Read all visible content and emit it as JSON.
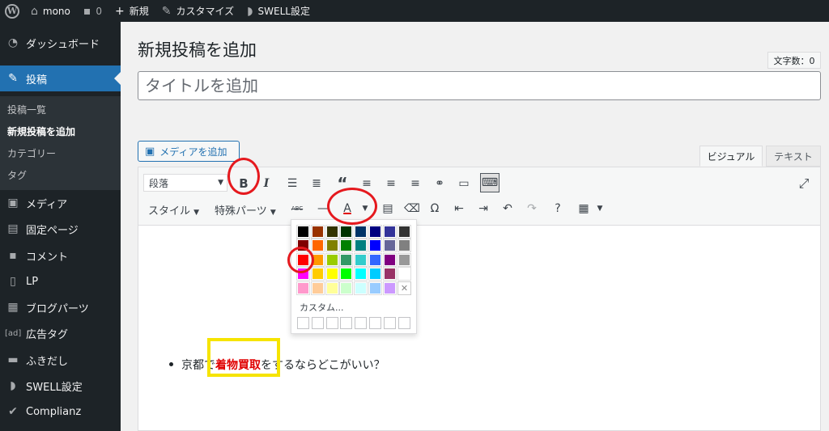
{
  "admin_bar": {
    "site_name": "mono",
    "comments_count": "0",
    "new_label": "新規",
    "customize_label": "カスタマイズ",
    "swell_label": "SWELL設定"
  },
  "sidebar": {
    "items": [
      {
        "label": "ダッシュボード",
        "icon": "dashboard-icon"
      },
      {
        "label": "投稿",
        "icon": "pin-icon"
      },
      {
        "label": "メディア",
        "icon": "media-icon"
      },
      {
        "label": "固定ページ",
        "icon": "page-icon"
      },
      {
        "label": "コメント",
        "icon": "comment-icon"
      },
      {
        "label": "LP",
        "icon": "document-icon"
      },
      {
        "label": "ブログパーツ",
        "icon": "layout-icon"
      },
      {
        "label": "広告タグ",
        "icon": "ad-icon"
      },
      {
        "label": "ふきだし",
        "icon": "speech-icon"
      },
      {
        "label": "SWELL設定",
        "icon": "swell-icon"
      },
      {
        "label": "Complianz",
        "icon": "check-icon"
      }
    ],
    "ad_icon_text": "[ad]",
    "submenu": [
      {
        "label": "投稿一覧"
      },
      {
        "label": "新規投稿を追加"
      },
      {
        "label": "カテゴリー"
      },
      {
        "label": "タグ"
      }
    ]
  },
  "page": {
    "title": "新規投稿を追加",
    "word_count": "文字数：0",
    "title_placeholder": "タイトルを追加",
    "media_button": "メディアを追加",
    "tab_visual": "ビジュアル",
    "tab_text": "テキスト"
  },
  "toolbar": {
    "format_select": "段落",
    "style_label": "スタイル",
    "special_parts_label": "特殊パーツ",
    "bold_glyph": "B",
    "italic_glyph": "I",
    "text_color_glyph": "A",
    "strike_glyph": "ABC"
  },
  "color_picker": {
    "custom_label": "カスタム...",
    "selected_color": "#ff0000",
    "rows": [
      [
        "#000000",
        "#993300",
        "#333300",
        "#003300",
        "#003366",
        "#000080",
        "#333399",
        "#333333"
      ],
      [
        "#800000",
        "#ff6600",
        "#808000",
        "#008000",
        "#008080",
        "#0000ff",
        "#666699",
        "#808080"
      ],
      [
        "#ff0000",
        "#ff9900",
        "#99cc00",
        "#339966",
        "#33cccc",
        "#3366ff",
        "#800080",
        "#999999"
      ],
      [
        "#ff00ff",
        "#ffcc00",
        "#ffff00",
        "#00ff00",
        "#00ffff",
        "#00ccff",
        "#993366",
        "#ffffff"
      ],
      [
        "#ff99cc",
        "#ffcc99",
        "#ffff99",
        "#ccffcc",
        "#ccffff",
        "#99ccff",
        "#cc99ff",
        "remove"
      ]
    ]
  },
  "content": {
    "bullet_prefix": "京都で",
    "bullet_highlight": "着物買取",
    "bullet_suffix": "をするならどこがいい？",
    "highlight_color": "#e00000"
  },
  "annotations": {
    "circle_color": "#e5191e",
    "rect_color": "#f6e400"
  }
}
